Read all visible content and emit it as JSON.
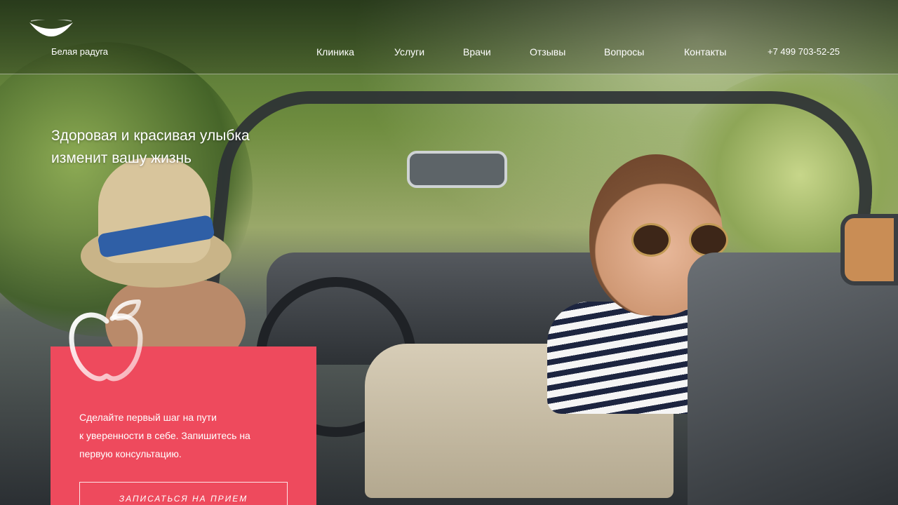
{
  "header": {
    "brand": "Белая радуга",
    "nav": [
      {
        "label": "Клиника"
      },
      {
        "label": "Услуги"
      },
      {
        "label": "Врачи"
      },
      {
        "label": "Отзывы"
      },
      {
        "label": "Вопросы"
      },
      {
        "label": "Контакты"
      }
    ],
    "phone": "+7 499 703-52-25"
  },
  "hero": {
    "headline_line1": "Здоровая и красивая улыбка",
    "headline_line2": "изменит вашу жизнь"
  },
  "card": {
    "text_line1": "Сделайте первый шаг на пути",
    "text_line2": "к уверенности в себе. Запишитесь на",
    "text_line3": "первую консультацию.",
    "button_label": "ЗАПИСАТЬСЯ НА ПРИЕМ"
  },
  "colors": {
    "accent": "#ee4a5d",
    "text": "#ffffff"
  },
  "icons": {
    "logo": "smile-arc-logo",
    "apple": "apple-outline-icon"
  }
}
